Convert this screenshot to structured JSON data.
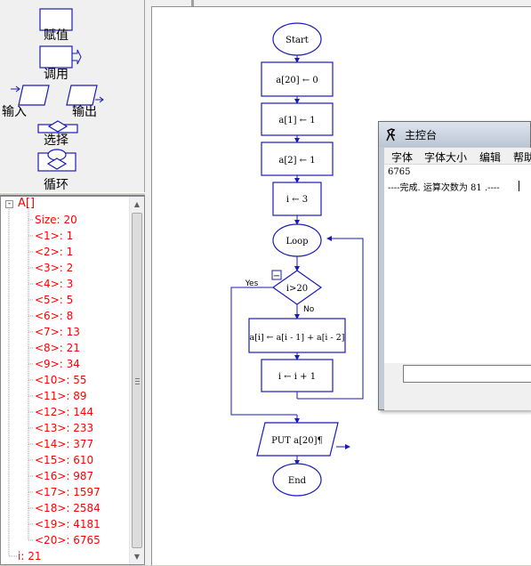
{
  "palette": {
    "tools": [
      {
        "label": "赋值"
      },
      {
        "label": "调用"
      },
      {
        "label": "输入"
      },
      {
        "label": "输出"
      },
      {
        "label": "选择"
      },
      {
        "label": "循环"
      }
    ]
  },
  "tree": {
    "root": {
      "label": "A[]",
      "toggle": "-"
    },
    "items": [
      {
        "label": "Size: 20"
      },
      {
        "label": "<1>: 1"
      },
      {
        "label": "<2>: 1"
      },
      {
        "label": "<3>: 2"
      },
      {
        "label": "<4>: 3"
      },
      {
        "label": "<5>: 5"
      },
      {
        "label": "<6>: 8"
      },
      {
        "label": "<7>: 13"
      },
      {
        "label": "<8>: 21"
      },
      {
        "label": "<9>: 34"
      },
      {
        "label": "<10>: 55"
      },
      {
        "label": "<11>: 89"
      },
      {
        "label": "<12>: 144"
      },
      {
        "label": "<13>: 233"
      },
      {
        "label": "<14>: 377"
      },
      {
        "label": "<15>: 610"
      },
      {
        "label": "<16>: 987"
      },
      {
        "label": "<17>: 1597"
      },
      {
        "label": "<18>: 2584"
      },
      {
        "label": "<19>: 4181"
      },
      {
        "label": "<20>: 6765"
      }
    ],
    "footer": {
      "label": "i: 21"
    },
    "text_color": "#ff0000"
  },
  "flowchart": {
    "start": "Start",
    "steps": [
      "a[20] ← 0",
      "a[1] ← 1",
      "a[2] ← 1",
      "i ← 3"
    ],
    "loop": "Loop",
    "decision": "i>20",
    "yes": "Yes",
    "no": "No",
    "body": [
      "a[i] ← a[i - 1] + a[i - 2]",
      "i ← i + 1"
    ],
    "output": "PUT a[20]¶",
    "end": "End",
    "collapse_glyph": "−",
    "stroke_color": "#1a1ab8"
  },
  "console": {
    "title": "主控台",
    "menu": [
      "字体",
      "字体大小",
      "编辑",
      "帮助"
    ],
    "output_lines": [
      "6765",
      "----完成. 运算次数为  81 .----"
    ],
    "input_value": ""
  }
}
